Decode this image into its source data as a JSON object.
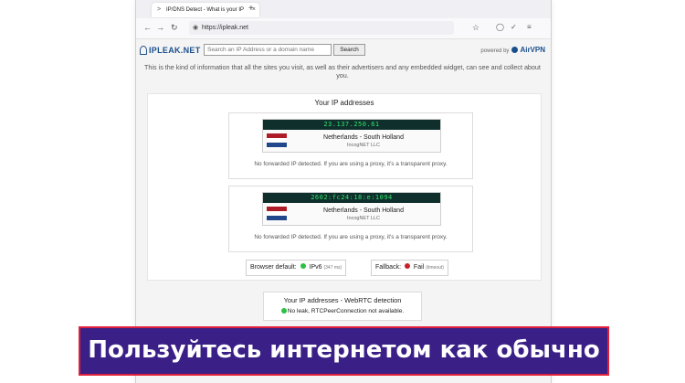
{
  "browser": {
    "tab_title": "IP/DNS Detect - What is your IP",
    "tab_close": "×",
    "new_tab": "+",
    "url": "https://ipleak.net",
    "nav_back": "←",
    "nav_forward": "→",
    "nav_reload": "↻"
  },
  "site": {
    "logo": "IPLEAK.NET",
    "search_placeholder": "Search an IP Address or a domain name",
    "search_button": "Search",
    "powered_by": "powered by",
    "powered_brand": "AirVPN",
    "intro": "This is the kind of information that all the sites you visit, as well as their advertisers and any embedded widget, can see and collect about you."
  },
  "ip_panel": {
    "title": "Your IP addresses",
    "cards": [
      {
        "ip": "23.137.250.61",
        "location": "Netherlands - South Holland",
        "isp": "IncogNET LLC",
        "note": "No forwarded IP detected. If you are using a proxy, it's a transparent proxy."
      },
      {
        "ip": "2602:fc24:18:e:1094",
        "location": "Netherlands - South Holland",
        "isp": "IncogNET LLC",
        "note": "No forwarded IP detected. If you are using a proxy, it's a transparent proxy."
      }
    ],
    "browser_default_label": "Browser default:",
    "browser_default_value": "IPv6",
    "browser_default_small": "(347 ms)",
    "fallback_label": "Fallback:",
    "fallback_value": "Fail",
    "fallback_small": "(timeout)"
  },
  "webrtc": {
    "title": "Your IP addresses - WebRTC detection",
    "message": "No leak, RTCPeerConnection not available."
  },
  "banner": {
    "text": "Пользуйтесь интернетом как обычно"
  },
  "colors": {
    "banner_bg": "#3a1f86",
    "banner_border": "#e0203a",
    "ip_text": "#2fe36b",
    "ok_dot": "#2bbf44",
    "fail_dot": "#c8202a",
    "flag_red": "#ae1c28",
    "flag_white": "#ffffff",
    "flag_blue": "#21468b"
  }
}
